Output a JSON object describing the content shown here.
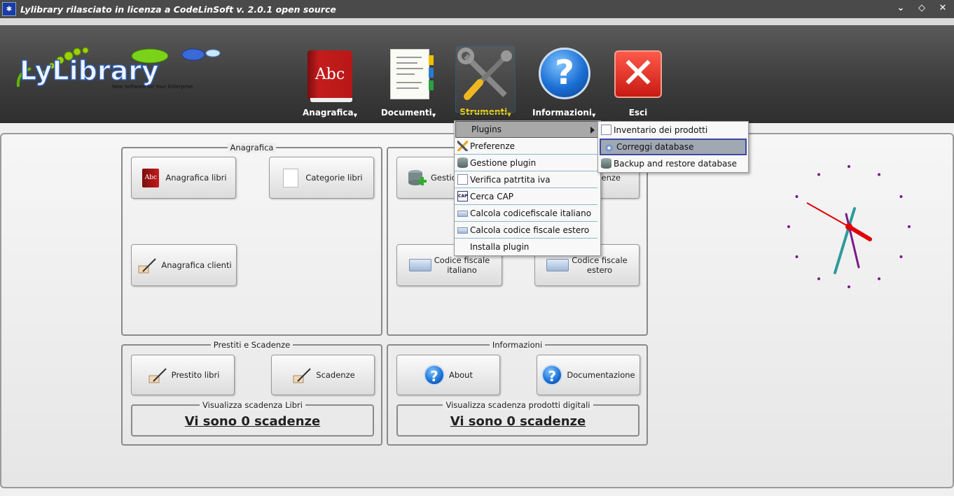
{
  "window": {
    "title": "Lylibrary rilasciato in licenza a CodeLinSoft  v. 2.0.1  open source",
    "controls": [
      "⌄",
      "◇",
      "✕"
    ]
  },
  "logo": {
    "name": "LyLibrary",
    "tagline": "New Software for Your Enterprise"
  },
  "toolbar": [
    {
      "label": "Anagrafica",
      "icon": "address-book-icon",
      "active": false
    },
    {
      "label": "Documenti",
      "icon": "notebook-icon",
      "active": false
    },
    {
      "label": "Strumenti",
      "icon": "tools-icon",
      "active": true
    },
    {
      "label": "Informazioni",
      "icon": "help-icon",
      "active": false
    },
    {
      "label": "Esci",
      "icon": "exit-icon",
      "active": false
    }
  ],
  "groups": {
    "anagrafica": {
      "title": "Anagrafica",
      "buttons": [
        "Anagrafica libri",
        "Categorie libri",
        "Anagrafica clienti"
      ]
    },
    "strumenti": {
      "buttons": [
        "Gestio",
        "enze",
        "Codice fiscale italiano",
        "Codice fiscale estero"
      ]
    },
    "prestiti": {
      "title": "Prestiti e Scadenze",
      "buttons": [
        "Prestito libri",
        "Scadenze"
      ],
      "banner_title": "Visualizza scadenza Libri",
      "banner_value": "Vi sono 0 scadenze"
    },
    "informazioni": {
      "title": "Informazioni",
      "buttons": [
        "About",
        "Documentazione"
      ],
      "banner_title": "Visualizza scadenza prodotti digitali",
      "banner_value": "Vi sono 0 scadenze"
    }
  },
  "menu": {
    "items": [
      {
        "label": "Plugins",
        "icon": "",
        "submenu": true
      },
      {
        "label": "Preferenze",
        "icon": "tools-icon"
      },
      {
        "label": "Gestione plugin",
        "icon": "database-icon"
      },
      {
        "label": "Verifica patrtita iva",
        "icon": "document-icon"
      },
      {
        "label": "Cerca CAP",
        "icon": "cap-icon"
      },
      {
        "label": "Calcola codicefiscale italiano",
        "icon": "id-card-icon"
      },
      {
        "label": "Calcola codice fiscale estero",
        "icon": "id-card-icon"
      },
      {
        "label": "Installa plugin",
        "icon": ""
      }
    ]
  },
  "submenu": {
    "items": [
      {
        "label": "Inventario dei prodotti",
        "icon": "document-icon"
      },
      {
        "label": "Correggi database",
        "icon": "database-fix-icon",
        "selected": true
      },
      {
        "label": "Backup and restore database",
        "icon": "backup-icon"
      }
    ]
  },
  "clock": {
    "marker_color": "#7a1a8a",
    "hour_hand_color": "#e00000",
    "minute_hand_color": "#2e9a9a",
    "second_hand_color": "#7a1a8a"
  }
}
